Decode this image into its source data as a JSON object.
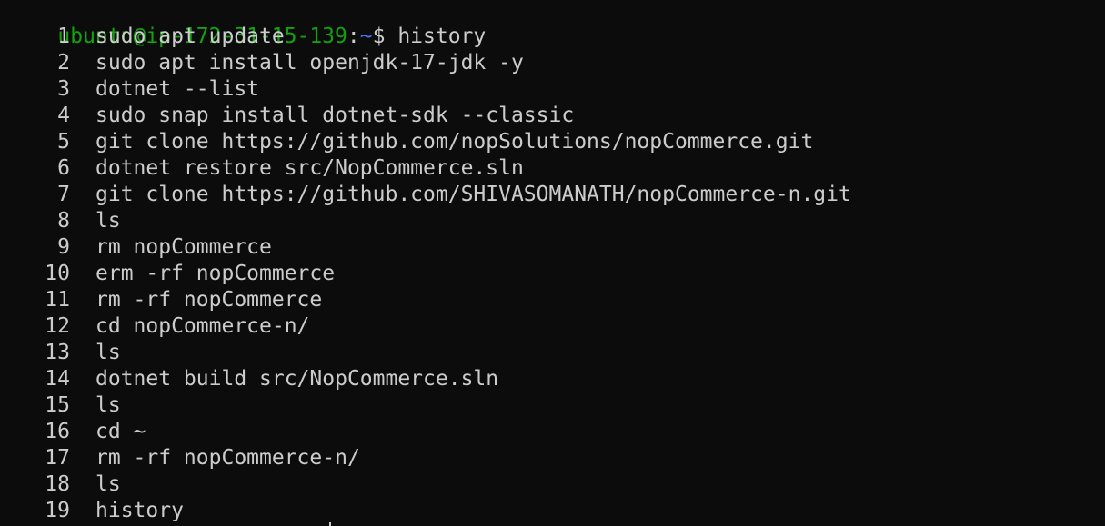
{
  "prompt": {
    "user_host": "ubuntu@ip-172-31-15-139",
    "colon": ":",
    "path": "~",
    "dollar": "$",
    "command": " history"
  },
  "history": [
    {
      "num": "1",
      "cmd": "sudo apt update"
    },
    {
      "num": "2",
      "cmd": "sudo apt install openjdk-17-jdk -y"
    },
    {
      "num": "3",
      "cmd": "dotnet --list"
    },
    {
      "num": "4",
      "cmd": "sudo snap install dotnet-sdk --classic"
    },
    {
      "num": "5",
      "cmd": "git clone https://github.com/nopSolutions/nopCommerce.git"
    },
    {
      "num": "6",
      "cmd": "dotnet restore src/NopCommerce.sln"
    },
    {
      "num": "7",
      "cmd": "git clone https://github.com/SHIVASOMANATH/nopCommerce-n.git"
    },
    {
      "num": "8",
      "cmd": "ls"
    },
    {
      "num": "9",
      "cmd": "rm nopCommerce"
    },
    {
      "num": "10",
      "cmd": "erm -rf nopCommerce"
    },
    {
      "num": "11",
      "cmd": "rm -rf nopCommerce"
    },
    {
      "num": "12",
      "cmd": "cd nopCommerce-n/"
    },
    {
      "num": "13",
      "cmd": "ls"
    },
    {
      "num": "14",
      "cmd": "dotnet build src/NopCommerce.sln"
    },
    {
      "num": "15",
      "cmd": "ls"
    },
    {
      "num": "16",
      "cmd": "cd ~"
    },
    {
      "num": "17",
      "cmd": "rm -rf nopCommerce-n/"
    },
    {
      "num": "18",
      "cmd": "ls"
    },
    {
      "num": "19",
      "cmd": "history"
    }
  ],
  "colors": {
    "background": "#0c0c0c",
    "foreground": "#cccccc",
    "prompt_user": "#13a10e",
    "prompt_path": "#3b78ff"
  }
}
